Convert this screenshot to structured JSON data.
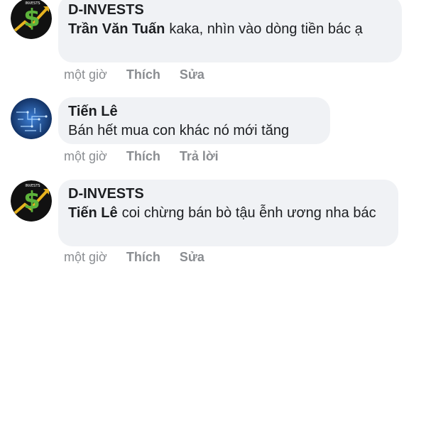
{
  "comments": [
    {
      "author": "D-INVESTS",
      "mention": "Trần Văn Tuấn",
      "text": "kaka, nhìn vào dòng tiền bác ạ",
      "time": "một giờ",
      "actions": [
        "Thích",
        "Sửa"
      ],
      "avatar_icon": "dollar-logo-icon",
      "avatar_text": "INVESTS"
    },
    {
      "author": "Tiến Lê",
      "mention": "",
      "text": "Bán hết mua con khác nó mới tăng",
      "time": "một giờ",
      "actions": [
        "Thích",
        "Trả lời"
      ],
      "avatar_icon": "circuit-blue-avatar-icon"
    },
    {
      "author": "D-INVESTS",
      "mention": "Tiến Lê",
      "text": "coi chừng bán bò tậu ễnh ương nha bác",
      "time": "một giờ",
      "actions": [
        "Thích",
        "Sửa"
      ],
      "avatar_icon": "dollar-logo-icon",
      "avatar_text": "INVESTS"
    }
  ],
  "colors": {
    "bubble": "#f0f2f5",
    "text": "#1c1e21",
    "meta": "#8a8d91",
    "logo_green": "#5db33b",
    "logo_gold": "#e6b21f"
  }
}
